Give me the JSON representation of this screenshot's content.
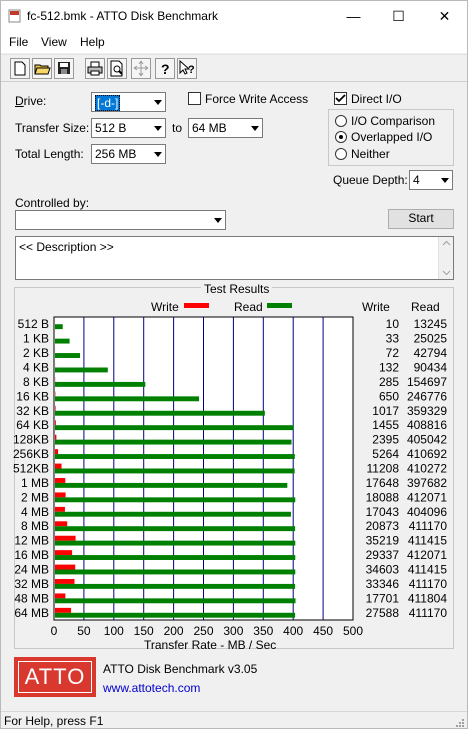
{
  "window": {
    "title": "fc-512.bmk - ATTO Disk Benchmark",
    "minimize_glyph": "—",
    "maximize_glyph": "☐",
    "close_glyph": "✕"
  },
  "menu": [
    "File",
    "View",
    "Help"
  ],
  "toolbar_icons": [
    "new-icon",
    "open-icon",
    "save-icon",
    "print-icon",
    "print-preview-icon",
    "move-icon",
    "help-icon",
    "context-help-icon"
  ],
  "form": {
    "drive_label": "Drive:",
    "drive_value": "[-d-]",
    "force_write_label": "Force Write Access",
    "direct_io_label": "Direct I/O",
    "transfer_size_label": "Transfer Size:",
    "transfer_from": "512 B",
    "to_label": "to",
    "transfer_to": "64 MB",
    "total_length_label": "Total Length:",
    "total_length_value": "256 MB",
    "io_comparison_label": "I/O Comparison",
    "overlapped_io_label": "Overlapped I/O",
    "neither_label": "Neither",
    "queue_depth_label": "Queue Depth:",
    "queue_depth_value": "4",
    "controlled_by_label": "Controlled by:",
    "controlled_by_value": "",
    "start_label": "Start",
    "description_text": "<< Description >>"
  },
  "results": {
    "title": "Test Results",
    "write_legend": "Write",
    "read_legend": "Read",
    "write_col_header": "Write",
    "read_col_header": "Read",
    "x_axis_label": "Transfer Rate - MB / Sec",
    "write_color": "#ff0000",
    "read_color": "#008000"
  },
  "chart_data": {
    "type": "bar",
    "orientation": "horizontal",
    "xlabel": "Transfer Rate - MB / Sec",
    "xlim": [
      0,
      500
    ],
    "xticks": [
      "0",
      "50",
      "100",
      "150",
      "200",
      "250",
      "300",
      "350",
      "400",
      "450",
      "500"
    ],
    "categories": [
      "512 B",
      "1 KB",
      "2 KB",
      "4 KB",
      "8 KB",
      "16 KB",
      "32 KB",
      "64 KB",
      "128KB",
      "256KB",
      "512KB",
      "1 MB",
      "2 MB",
      "4 MB",
      "8 MB",
      "12 MB",
      "16 MB",
      "24 MB",
      "32 MB",
      "48 MB",
      "64 MB"
    ],
    "series": [
      {
        "name": "Write",
        "color": "#ff0000",
        "values": [
          0.01,
          0.03,
          0.07,
          0.13,
          0.28,
          0.63,
          0.99,
          1.42,
          2.34,
          5.14,
          10.9,
          17.2,
          17.7,
          16.6,
          20.4,
          34.4,
          28.6,
          33.8,
          32.6,
          17.3,
          26.9
        ]
      },
      {
        "name": "Read",
        "color": "#008000",
        "values": [
          12.9,
          24.4,
          41.8,
          88.3,
          151.0,
          240.9,
          350.9,
          399.2,
          395.5,
          401.0,
          400.7,
          388.5,
          401.8,
          394.6,
          401.5,
          401.8,
          401.8,
          401.8,
          401.5,
          402.2,
          401.5
        ]
      }
    ],
    "table": {
      "write": [
        "10",
        "33",
        "72",
        "132",
        "285",
        "650",
        "1017",
        "1455",
        "2395",
        "5264",
        "11208",
        "17648",
        "18088",
        "17043",
        "20873",
        "35219",
        "29337",
        "34603",
        "33346",
        "17701",
        "27588"
      ],
      "read": [
        "13245",
        "25025",
        "42794",
        "90434",
        "154697",
        "246776",
        "359329",
        "408816",
        "405042",
        "410692",
        "410272",
        "397682",
        "412071",
        "404096",
        "411170",
        "411415",
        "412071",
        "411415",
        "411170",
        "411804",
        "411170"
      ]
    }
  },
  "footer": {
    "logo_text": "ATTO",
    "product": "ATTO Disk Benchmark v3.05",
    "url": "www.attotech.com"
  },
  "status": "For Help, press F1"
}
